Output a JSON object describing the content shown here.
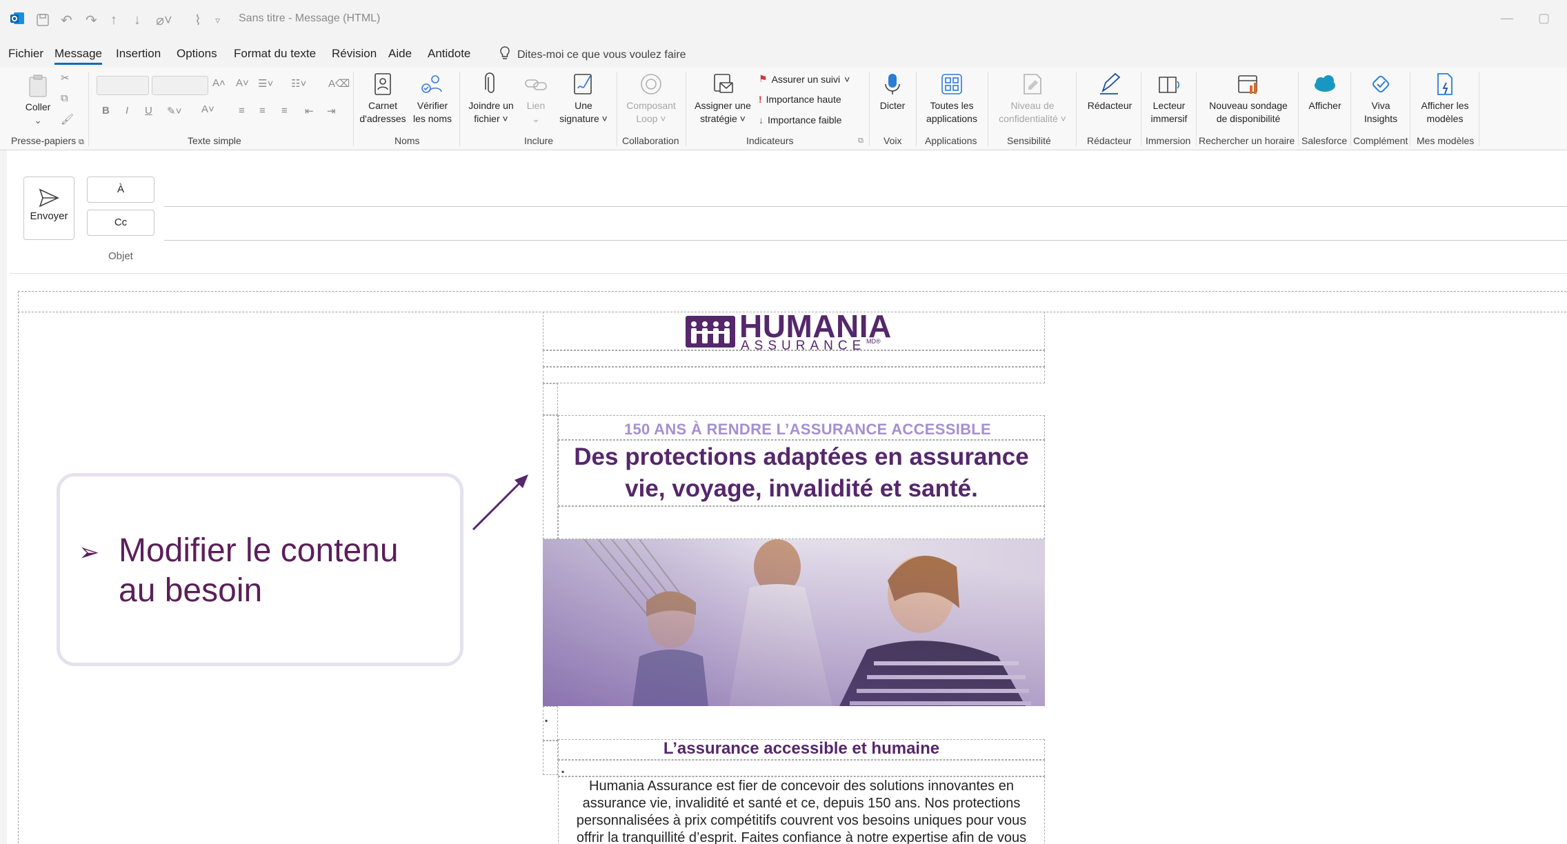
{
  "window": {
    "title": "Sans titre  -  Message (HTML)"
  },
  "menu": {
    "tabs": [
      "Fichier",
      "Message",
      "Insertion",
      "Options",
      "Format du texte",
      "Révision",
      "Aide",
      "Antidote"
    ],
    "active_tab": "Message",
    "tell_me": "Dites-moi ce que vous voulez faire"
  },
  "ribbon": {
    "groups": {
      "clipboard": "Presse-papiers",
      "basic_text": "Texte simple",
      "names": "Noms",
      "include": "Inclure",
      "collaboration": "Collaboration",
      "tags": "Indicateurs",
      "voice": "Voix",
      "applications": "Applications",
      "sensitivity": "Sensibilité",
      "editor": "Rédacteur",
      "immersive": "Immersion",
      "scheduling": "Rechercher un horaire",
      "salesforce": "Salesforce",
      "addin": "Complément",
      "templates": "Mes modèles"
    },
    "buttons": {
      "paste": "Coller",
      "address_book_1": "Carnet",
      "address_book_2": "d'adresses",
      "check_names_1": "Vérifier",
      "check_names_2": "les noms",
      "attach_1": "Joindre un",
      "attach_2": "fichier",
      "link": "Lien",
      "signature_1": "Une",
      "signature_2": "signature",
      "loop_1": "Composant",
      "loop_2": "Loop",
      "policy_1": "Assigner une",
      "policy_2": "stratégie",
      "follow_up": "Assurer un suivi",
      "high_importance": "Importance haute",
      "low_importance": "Importance faible",
      "dictate": "Dicter",
      "all_apps_1": "Toutes les",
      "all_apps_2": "applications",
      "sensitivity_1": "Niveau de",
      "sensitivity_2": "confidentialité",
      "editor": "Rédacteur",
      "reader_1": "Lecteur",
      "reader_2": "immersif",
      "poll_1": "Nouveau sondage",
      "poll_2": "de disponibilité",
      "show": "Afficher",
      "viva_1": "Viva",
      "viva_2": "Insights",
      "templates_1": "Afficher les",
      "templates_2": "modèles"
    }
  },
  "compose": {
    "send": "Envoyer",
    "to": "À",
    "cc": "Cc",
    "subject": "Objet"
  },
  "email": {
    "logo_main": "HUMANIA",
    "logo_sub": "ASSURANCE",
    "logo_mark": "MD®",
    "tagline": "150 ANS À RENDRE L’ASSURANCE ACCESSIBLE",
    "headline": "Des protections adaptées en assurance vie, voyage, invalidité et santé.",
    "subheading": "L’assurance accessible et humaine",
    "body": "Humania Assurance est fier de concevoir des solutions innovantes en assurance vie, invalidité et santé et ce, depuis 150 ans. Nos protections personnalisées à prix compétitifs couvrent vos besoins uniques pour vous offrir la tranquillité d’esprit. Faites confiance à notre expertise afin de vous"
  },
  "callout": {
    "text": "Modifier le contenu au besoin"
  },
  "colors": {
    "brand_purple": "#55276b",
    "tagline_lavender": "#a58fcf",
    "callout_text": "#5b1f5a",
    "accent_blue": "#0f6cbd"
  }
}
